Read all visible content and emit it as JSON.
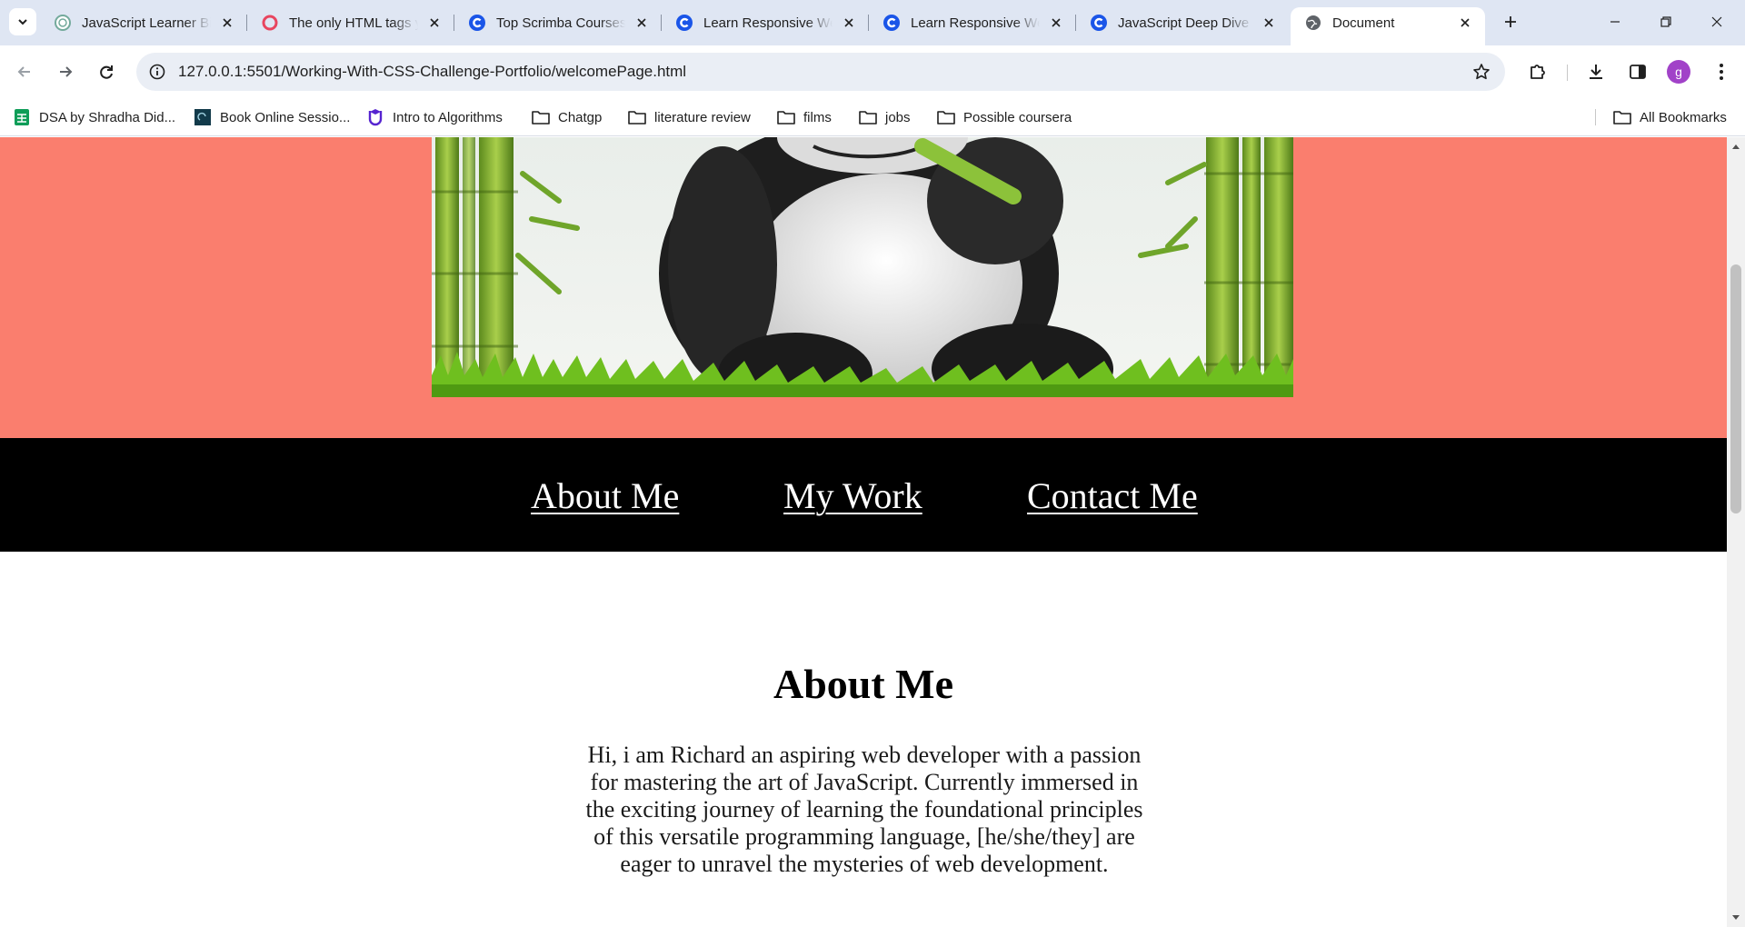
{
  "browser": {
    "tabs": [
      {
        "title": "JavaScript Learner Bio",
        "icon": "chatgpt-icon"
      },
      {
        "title": "The only HTML tags you",
        "icon": "scribble-icon"
      },
      {
        "title": "Top Scrimba Courses",
        "icon": "scrimba-icon"
      },
      {
        "title": "Learn Responsive Web",
        "icon": "scrimba-icon"
      },
      {
        "title": "Learn Responsive Web",
        "icon": "scrimba-icon"
      },
      {
        "title": "JavaScript Deep Dive",
        "icon": "scrimba-icon"
      },
      {
        "title": "Document",
        "icon": "globe-icon",
        "active": true
      }
    ],
    "url": "127.0.0.1:5501/Working-With-CSS-Challenge-Portfolio/welcomePage.html",
    "profile_initial": "g",
    "bookmarks": [
      {
        "label": "DSA by Shradha Did...",
        "icon": "sheets-icon"
      },
      {
        "label": "Book Online Sessio...",
        "icon": "site-icon"
      },
      {
        "label": "Intro to Algorithms",
        "icon": "udemy-icon"
      },
      {
        "label": "Chatgp",
        "icon": "folder-icon"
      },
      {
        "label": "literature review",
        "icon": "folder-icon"
      },
      {
        "label": "films",
        "icon": "folder-icon"
      },
      {
        "label": "jobs",
        "icon": "folder-icon"
      },
      {
        "label": "Possible coursera",
        "icon": "folder-icon"
      }
    ],
    "all_bookmarks": "All Bookmarks"
  },
  "page": {
    "nav": {
      "about": "About Me",
      "work": "My Work",
      "contact": "Contact Me"
    },
    "about": {
      "heading": "About Me",
      "text": "Hi, i am Richard an aspiring web developer with a passion for mastering the art of JavaScript. Currently immersed in the exciting journey of learning the foundational principles of this versatile programming language, [he/she/they] are eager to unravel the mysteries of web development."
    }
  },
  "colors": {
    "hero_bg": "#fa7e6e",
    "nav_bg": "#000000",
    "tabstrip_bg": "#dfe6f3",
    "profile": "#a142c8"
  }
}
